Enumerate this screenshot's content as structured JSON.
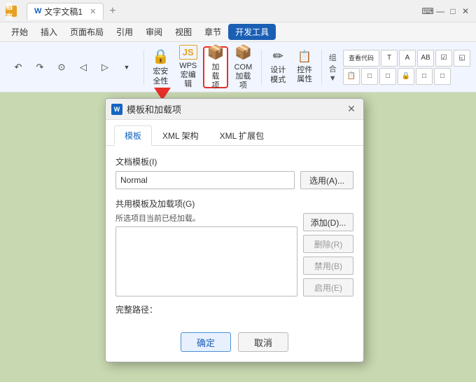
{
  "titlebar": {
    "logo": "稻壳",
    "app_icon": "W",
    "doc_title": "文字文稿1",
    "close_icon": "✕",
    "minimize_icon": "□",
    "chat_icon": "⌨"
  },
  "menubar": {
    "items": [
      "开始",
      "插入",
      "页面布局",
      "引用",
      "审阅",
      "视图",
      "章节"
    ],
    "active_item": "开发工具"
  },
  "toolbar": {
    "quick_buttons": [
      "↶",
      "↷",
      "⊙",
      "◁",
      "▷",
      "▼"
    ],
    "buttons": [
      {
        "id": "security",
        "icon": "🔒",
        "label": "宏安全性"
      },
      {
        "id": "wps-macro",
        "icon": "JS",
        "label": "WPS 宏编辑",
        "is_js": true
      },
      {
        "id": "addins",
        "icon": "📦",
        "label": "加载项",
        "highlighted": true
      },
      {
        "id": "com-addins",
        "icon": "📦",
        "label": "COM 加载项"
      },
      {
        "id": "design-mode",
        "icon": "✏",
        "label": "设计模式"
      },
      {
        "id": "control-props",
        "icon": "📋",
        "label": "控件属性"
      },
      {
        "id": "combine",
        "icon": "🔗",
        "label": "组合▼"
      }
    ],
    "right_buttons": [
      {
        "label": "查看代码"
      },
      {
        "label": "T"
      },
      {
        "label": "A"
      },
      {
        "label": "AB"
      },
      {
        "label": "☑"
      },
      {
        "label": "◱"
      },
      {
        "label": "📋"
      },
      {
        "label": "□"
      },
      {
        "label": "□"
      },
      {
        "label": "🔒"
      },
      {
        "label": "□"
      },
      {
        "label": "□"
      }
    ]
  },
  "dialog": {
    "title": "模板和加载项",
    "title_icon": "W",
    "close_label": "✕",
    "tabs": [
      "模板",
      "XML 架构",
      "XML 扩展包"
    ],
    "active_tab": "模板",
    "doc_template_label": "文档模板(I)",
    "doc_template_value": "Normal",
    "select_btn_label": "选用(A)...",
    "shared_section_label": "共用模板及加载项(G)",
    "shared_info": "所选项目当前已经加载。",
    "action_buttons": [
      {
        "label": "添加(D)...",
        "disabled": false
      },
      {
        "label": "删除(R)",
        "disabled": true
      },
      {
        "label": "禁用(B)",
        "disabled": true
      },
      {
        "label": "启用(E)",
        "disabled": true
      }
    ],
    "full_path_label": "完整路径：",
    "confirm_label": "确定",
    "cancel_label": "取消"
  },
  "arrow": {
    "color": "#e8302a"
  }
}
